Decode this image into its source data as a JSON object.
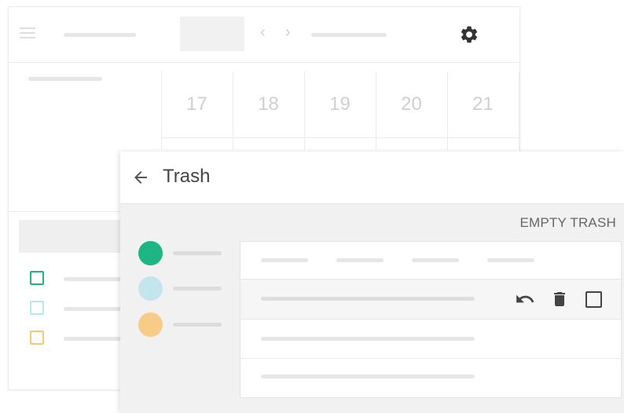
{
  "calendar": {
    "days": [
      "17",
      "18",
      "19",
      "20",
      "21"
    ],
    "calendar_colors": [
      "#1db584",
      "#b9e5ec",
      "#f6c875"
    ],
    "icons": {
      "menu": "menu-icon",
      "prev": "chevron-left-icon",
      "next": "chevron-right-icon",
      "settings": "gear-icon"
    },
    "chevron_left": "‹",
    "chevron_right": "›"
  },
  "trash": {
    "title": "Trash",
    "empty_trash_label": "EMPTY TRASH",
    "back_glyph": "←",
    "label_colors": [
      "#1db584",
      "#c3e5ec",
      "#f6cc86"
    ],
    "row_action_icons": [
      "undo-icon",
      "delete-icon",
      "checkbox-icon"
    ]
  }
}
